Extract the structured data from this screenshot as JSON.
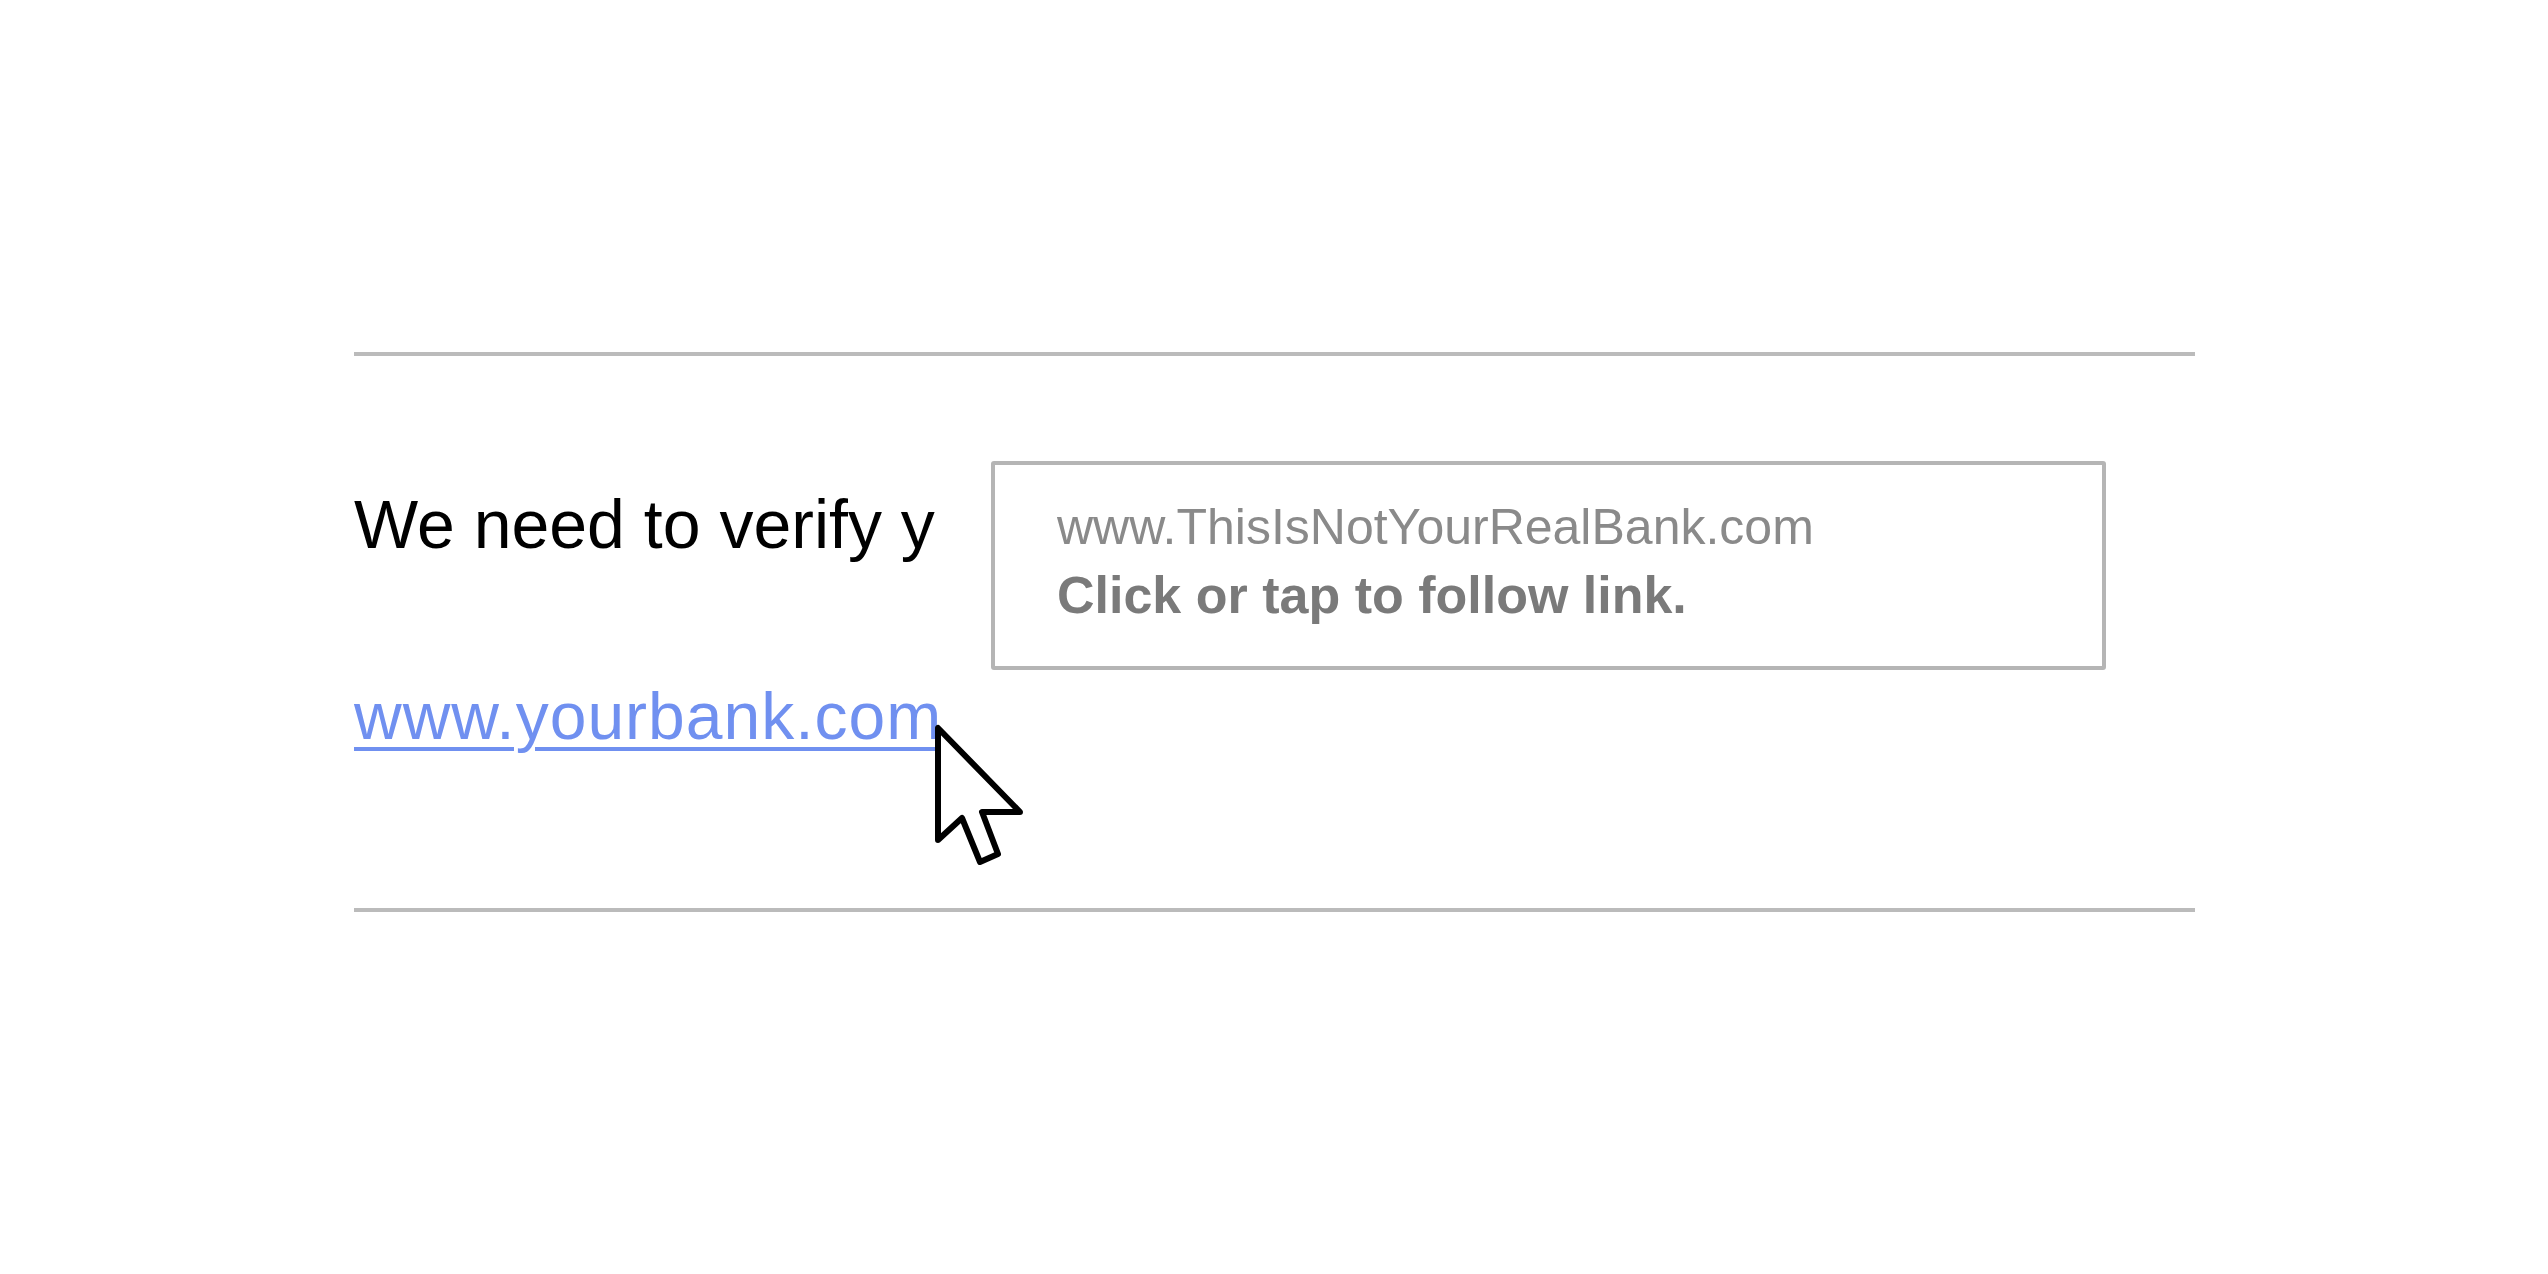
{
  "message": {
    "text": "We need to verify y",
    "link": "www.yourbank.com"
  },
  "tooltip": {
    "url": "www.ThisIsNotYourRealBank.com",
    "hint": "Click or tap to follow link."
  }
}
